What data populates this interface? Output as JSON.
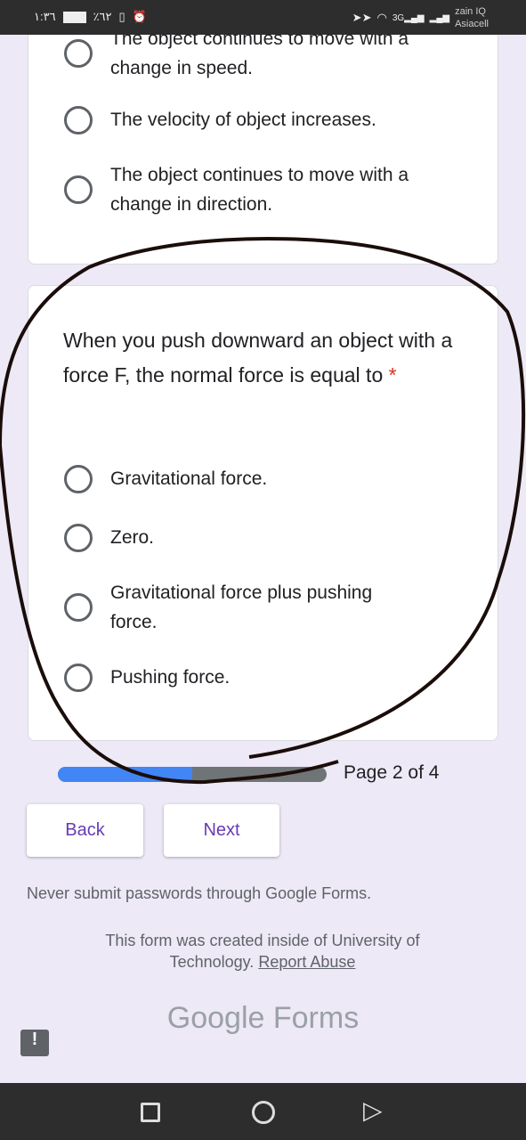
{
  "status_bar": {
    "time": "١:٣٦",
    "battery": "٪٦٢",
    "carrier1": "zain IQ",
    "carrier2": "Asiacell",
    "network": "3G"
  },
  "previous_question": {
    "options": [
      {
        "label": "The object continues to move with a change in speed."
      },
      {
        "label": "The velocity of object increases."
      },
      {
        "label": "The object continues to move with a change in direction."
      }
    ]
  },
  "question": {
    "title": "When you push downward an object with a force F, the normal force is equal to",
    "required_mark": "*",
    "options": [
      {
        "label": "Gravitational force."
      },
      {
        "label": "Zero."
      },
      {
        "label": "Gravitational force plus pushing force."
      },
      {
        "label": "Pushing force."
      }
    ]
  },
  "progress": {
    "label": "Page 2 of 4",
    "percent": 50,
    "color": "#4285f4"
  },
  "buttons": {
    "back": "Back",
    "next": "Next"
  },
  "footer": {
    "warning": "Never submit passwords through Google Forms.",
    "created": "This form was created inside of University of Technology.",
    "report": "Report Abuse",
    "logo": "Google Forms"
  },
  "colors": {
    "accent": "#673ab7",
    "background": "#ede9f6",
    "required": "#d93025"
  }
}
